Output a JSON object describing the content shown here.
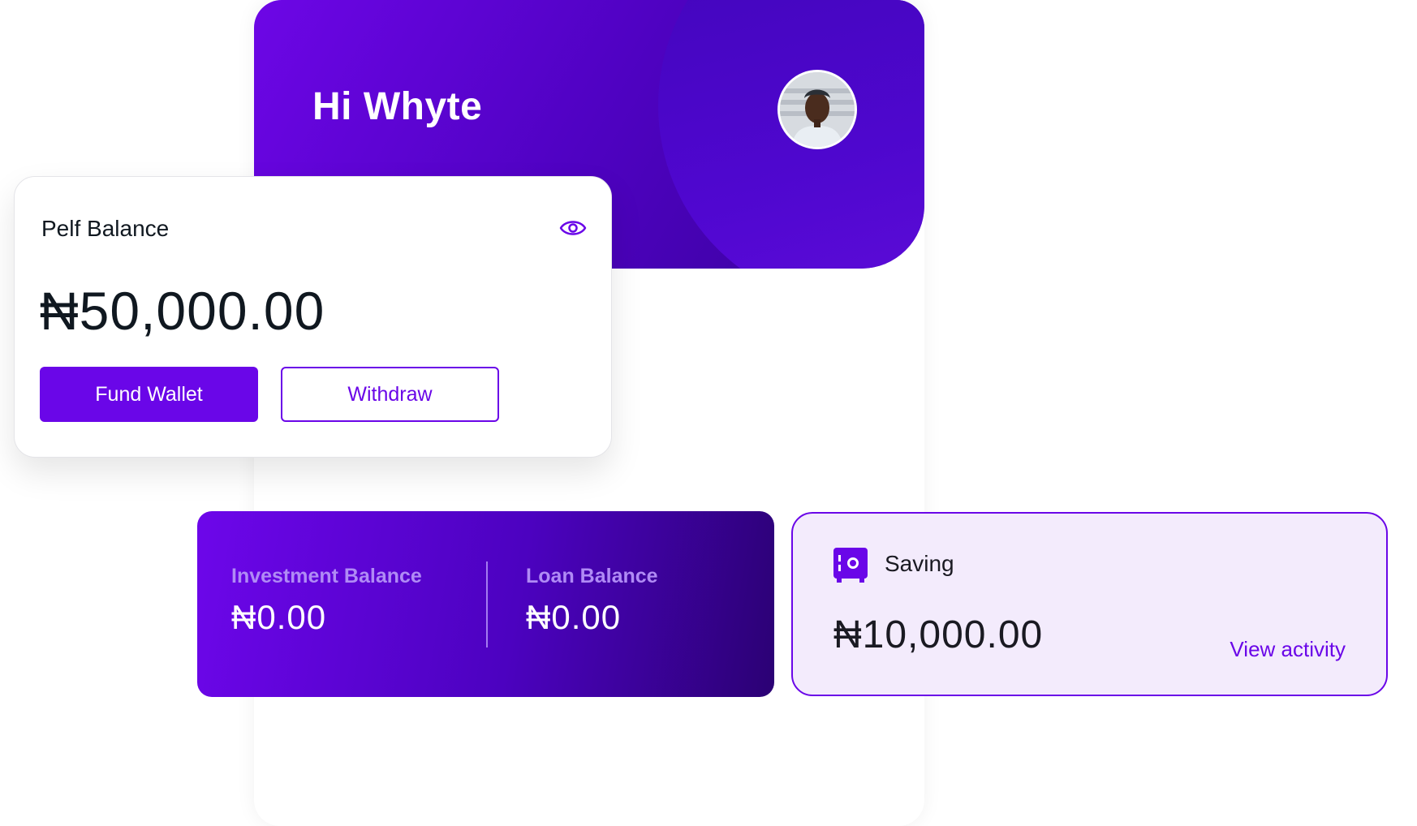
{
  "header": {
    "greeting": "Hi Whyte"
  },
  "balance_card": {
    "title": "Pelf Balance",
    "amount": "₦50,000.00",
    "fund_label": "Fund Wallet",
    "withdraw_label": "Withdraw"
  },
  "investment_card": {
    "investment_label": "Investment Balance",
    "investment_value": "₦0.00",
    "loan_label": "Loan Balance",
    "loan_value": "₦0.00"
  },
  "saving_card": {
    "label": "Saving",
    "amount": "₦10,000.00",
    "link_label": "View activity"
  },
  "icons": {
    "eye": "eye-icon",
    "safe": "safe-icon",
    "avatar": "avatar"
  },
  "colors": {
    "brand_purple": "#6a06e8",
    "dark_purple": "#2b0174",
    "label_purple": "#b08bf5",
    "text_dark": "#101820",
    "saving_bg": "#f2eafc"
  }
}
